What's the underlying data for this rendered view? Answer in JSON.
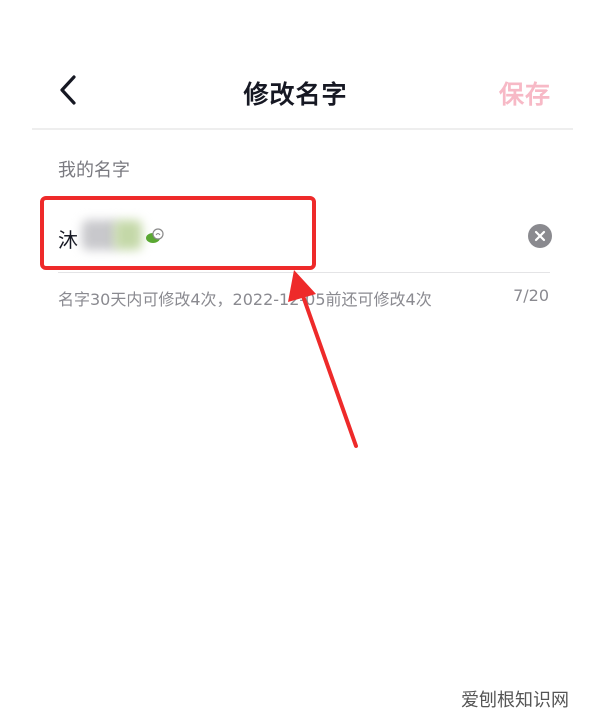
{
  "header": {
    "title": "修改名字",
    "save_label": "保存"
  },
  "form": {
    "label": "我的名字",
    "name_value_visible": "沐",
    "hint": "名字30天内可修改4次，2022-12-05前还可修改4次",
    "counter": "7/20"
  },
  "watermark": "爱刨根知识网",
  "colors": {
    "save": "#f7b9c6",
    "highlight": "#ee2a2a"
  },
  "icons": {
    "back": "chevron-left-icon",
    "clear": "clear-circle-icon"
  }
}
